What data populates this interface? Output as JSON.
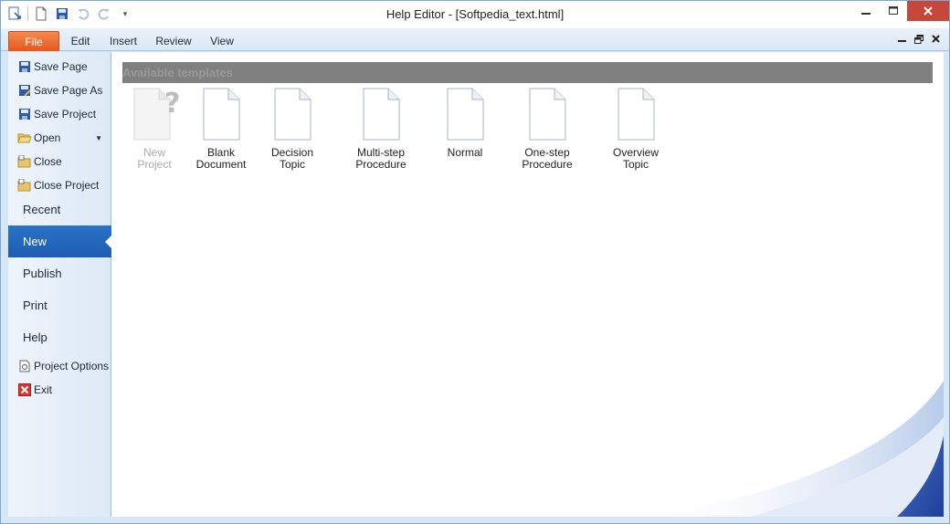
{
  "window": {
    "title": "Help Editor - [Softpedia_text.html]"
  },
  "quick_access": {
    "icons": [
      "app-icon",
      "new-doc-icon",
      "save-icon",
      "undo-icon",
      "redo-icon",
      "customize-icon"
    ]
  },
  "menu": {
    "tabs": [
      {
        "label": "File",
        "active": true
      },
      {
        "label": "Edit"
      },
      {
        "label": "Insert"
      },
      {
        "label": "Review"
      },
      {
        "label": "View"
      }
    ]
  },
  "nav": {
    "save_page": "Save Page",
    "save_page_as": "Save Page As",
    "save_project": "Save Project",
    "open": "Open",
    "close": "Close",
    "close_project": "Close Project",
    "recent": "Recent",
    "new": "New",
    "publish": "Publish",
    "print": "Print",
    "help": "Help",
    "project_options": "Project Options",
    "exit": "Exit"
  },
  "content": {
    "header": "Available templates",
    "templates": [
      {
        "label": "New Project",
        "disabled": true
      },
      {
        "label": "Blank Document"
      },
      {
        "label": "Decision Topic"
      },
      {
        "label": "Multi-step Procedure"
      },
      {
        "label": "Normal"
      },
      {
        "label": "One-step Procedure"
      },
      {
        "label": "Overview Topic"
      }
    ]
  },
  "colors": {
    "file_tab": "#e4581e",
    "nav_active": "#1d5db2",
    "header_bar": "#808080",
    "close_button": "#c7473a"
  }
}
